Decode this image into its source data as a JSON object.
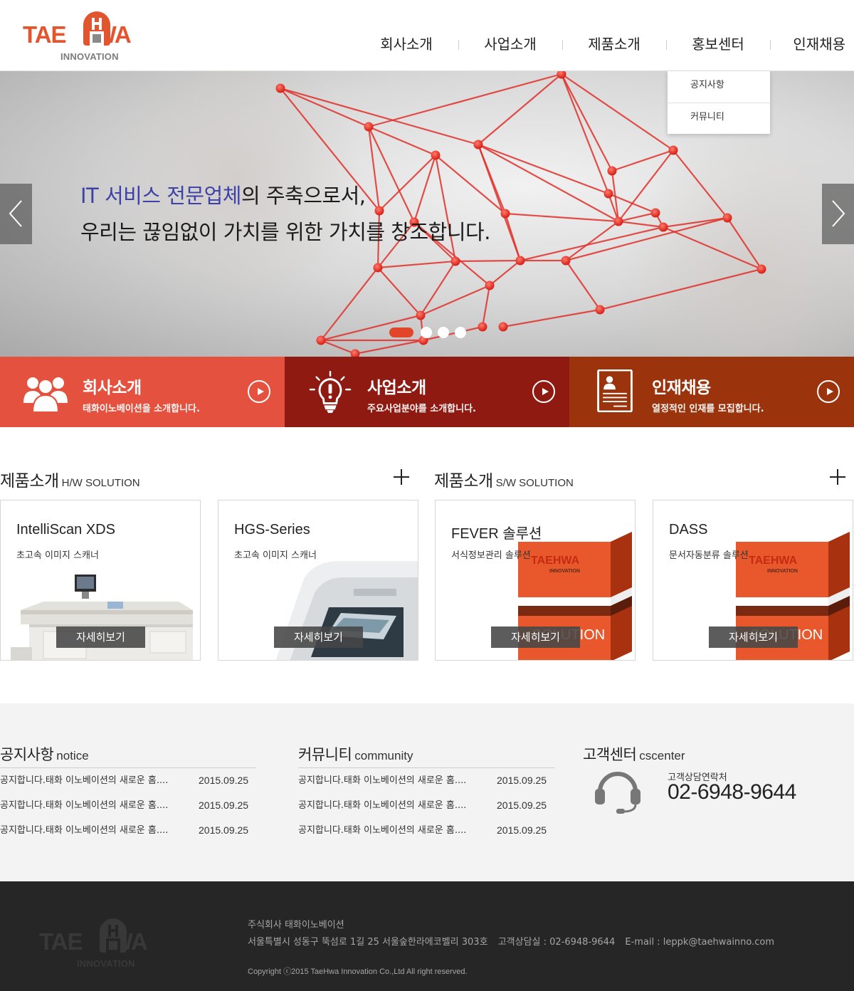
{
  "brand": {
    "logo_top_left": "TAE",
    "logo_top_right": "WA",
    "logo_bottom": "INNOVATION"
  },
  "nav": {
    "items": [
      "회사소개",
      "사업소개",
      "제품소개",
      "홍보센터",
      "인재채용"
    ],
    "submenu": [
      "공지사항",
      "커뮤니티"
    ]
  },
  "hero": {
    "line1_accent": "IT 서비스 전문업체",
    "line1_rest": "의 주축으로서,",
    "line2": "우리는 끊임없이 가치를 위한 가치를 창조합니다.",
    "slides": 4,
    "active_slide": 1
  },
  "quick": [
    {
      "title": "회사소개",
      "sub": "태화이노베이션을 소개합니다.",
      "icon": "people-icon",
      "color": "#e5513f"
    },
    {
      "title": "사업소개",
      "sub": "주요사업분야를 소개합니다.",
      "icon": "lightbulb-icon",
      "color": "#8e1a11"
    },
    {
      "title": "인재채용",
      "sub": "열정적인 인재를 모집합니다.",
      "icon": "resume-icon",
      "color": "#9b340d"
    }
  ],
  "products": {
    "hw": {
      "title": "제품소개",
      "sub": "H/W SOLUTION"
    },
    "sw": {
      "title": "제품소개",
      "sub": "S/W SOLUTION"
    },
    "detail_label": "자세히보기",
    "box_brand": "TAEHWA",
    "box_brand_sub": "INNOVATION",
    "box_label": "SOLUTION",
    "items": [
      {
        "name": "IntelliScan XDS",
        "desc": "초고속 이미지 스캐너"
      },
      {
        "name": "HGS-Series",
        "desc": "초고속 이미지 스캐너"
      },
      {
        "name": "FEVER 솔루션",
        "desc": "서식정보관리 솔루션"
      },
      {
        "name": "DASS",
        "desc": "문서자동분류 솔루션"
      }
    ]
  },
  "board": {
    "notice": {
      "title": "공지사항",
      "sub": "notice",
      "rows": [
        {
          "text": "공지합니다.태화 이노베이션의 새로운 홈....",
          "date": "2015.09.25"
        },
        {
          "text": "공지합니다.태화 이노베이션의 새로운 홈....",
          "date": "2015.09.25"
        },
        {
          "text": "공지합니다.태화 이노베이션의 새로운 홈....",
          "date": "2015.09.25"
        }
      ]
    },
    "community": {
      "title": "커뮤니티",
      "sub": "community",
      "rows": [
        {
          "text": "공지합니다.태화 이노베이션의 새로운 홈....",
          "date": "2015.09.25"
        },
        {
          "text": "공지합니다.태화 이노베이션의 새로운 홈....",
          "date": "2015.09.25"
        },
        {
          "text": "공지합니다.태화 이노베이션의 새로운 홈....",
          "date": "2015.09.25"
        }
      ]
    },
    "cs": {
      "title": "고객센터",
      "sub": "cscenter",
      "label": "고객상담연락처",
      "phone": "02-6948-9644",
      "icon": "headset-icon"
    }
  },
  "footer": {
    "company": "주식회사 태화이노베이션",
    "address": "서울특별시 성동구 뚝섬로 1길 25 서울숲한라에코벨리 303호",
    "tel": "고객상담실 : 02-6948-9644",
    "email": "E-mail : leppk@taehwainno.com",
    "copyright": "Copyright ⓒ2015 TaeHwa Innovation Co.,Ltd All right reserved."
  },
  "colors": {
    "brand": "#e2562f",
    "accent_text": "#3c42a8",
    "footer_bg": "#262626",
    "board_bg": "#f3f3f3"
  }
}
